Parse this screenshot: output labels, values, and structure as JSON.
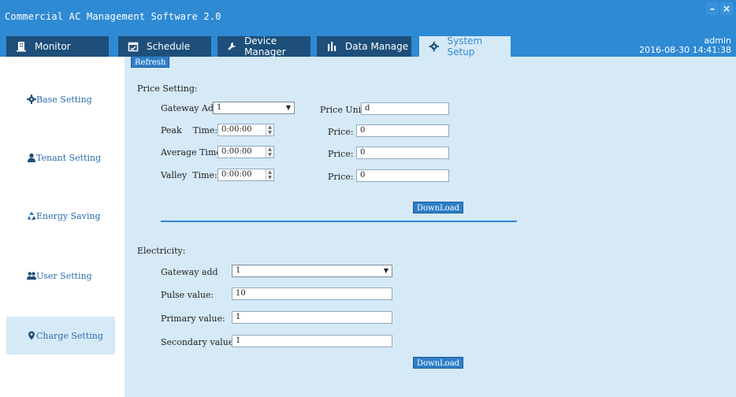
{
  "window": {
    "title": "Commercial AC Management Software 2.0",
    "minimize": "–",
    "close": "×"
  },
  "tabs": [
    {
      "label": "Monitor",
      "icon": "building-icon"
    },
    {
      "label": "Schedule",
      "icon": "calendar-icon"
    },
    {
      "label": "Device Manager",
      "icon": "wrench-icon"
    },
    {
      "label": "Data Manage",
      "icon": "bar-chart-icon"
    },
    {
      "label": "System Setup",
      "icon": "gear-icon",
      "active": true
    }
  ],
  "user": {
    "name": "admin",
    "datetime": "2016-08-30 14:41:38"
  },
  "sidebar": {
    "items": [
      {
        "label": "Base Setting",
        "icon": "gear-icon"
      },
      {
        "label": "Tenant Setting",
        "icon": "person-icon"
      },
      {
        "label": "Energy Saving",
        "icon": "recycle-icon"
      },
      {
        "label": "User Setting",
        "icon": "users-icon"
      },
      {
        "label": "Charge Setting",
        "icon": "location-pin-icon",
        "active": true
      }
    ]
  },
  "toolbar": {
    "refresh_label": "Refresh"
  },
  "price_setting": {
    "heading": "Price Setting:",
    "gateway_label": "Gateway Addr",
    "gateway_value": "1",
    "price_unit_label": "Price Uni",
    "price_unit_value": "d",
    "rows": [
      {
        "label": "Peak    Time:",
        "time": "0:00:00",
        "price_label": "Price:",
        "price": "0"
      },
      {
        "label": "Average Time:",
        "time": "0:00:00",
        "price_label": "Price:",
        "price": "0"
      },
      {
        "label": "Valley  Time:",
        "time": "0:00:00",
        "price_label": "Price:",
        "price": "0"
      }
    ],
    "download_label": "DownLoad"
  },
  "electricity": {
    "heading": "Electricity:",
    "gateway_label": "Gateway add",
    "gateway_value": "1",
    "pulse_label": "Pulse value:",
    "pulse_value": "10",
    "primary_label": "Primary value:",
    "primary_value": "1",
    "secondary_label": "Secondary value:",
    "secondary_value": "1",
    "download_label": "DownLoad"
  }
}
